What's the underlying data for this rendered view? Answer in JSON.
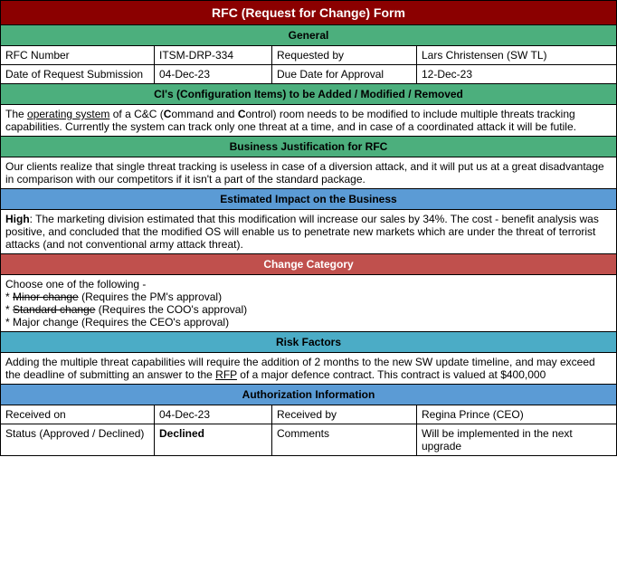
{
  "title": "RFC (Request for Change) Form",
  "sections": {
    "general": {
      "label": "General",
      "rfc_number_label": "RFC Number",
      "rfc_number_value": "ITSM-DRP-334",
      "requested_by_label": "Requested by",
      "requested_by_value": "Lars Christensen (SW TL)",
      "date_submission_label": "Date of Request Submission",
      "date_submission_value": "04-Dec-23",
      "due_date_label": "Due Date for Approval",
      "due_date_value": "12-Dec-23"
    },
    "ci": {
      "label": "CI's (Configuration Items) to be Added / Modified / Removed",
      "content": "The operating system of a C&C (Command and Control) room needs to be modified to include multiple threats tracking capabilities. Currently the system can track only one threat at a time, and in case of a coordinated attack it will be futile."
    },
    "business_justification": {
      "label": "Business Justification for RFC",
      "content": "Our clients realize that single threat tracking is useless in case of a diversion attack, and it will put us at a great disadvantage in comparison with our competitors if it isn't a part of the standard package."
    },
    "estimated_impact": {
      "label": "Estimated Impact on the Business",
      "content_bold": "High",
      "content_rest": ": The marketing division estimated that this modification will increase our sales by 34%. The cost - benefit analysis was positive, and concluded that the modified OS will enable us to penetrate new markets which are under the threat of terrorist attacks (and not conventional army attack threat)."
    },
    "change_category": {
      "label": "Change Category",
      "line1": "Choose one of the following -",
      "line2_prefix": "* ",
      "line2_strike": "Minor change",
      "line2_suffix": " (Requires the PM's approval)",
      "line3_prefix": "* ",
      "line3_strike": "Standard change",
      "line3_suffix": " (Requires the COO's approval)",
      "line4": "* Major change (Requires the CEO's approval)"
    },
    "risk_factors": {
      "label": "Risk Factors",
      "content_pre": "Adding the multiple threat capabilities will require the addition of 2 months to the new SW update timeline, and may exceed the deadline of submitting an answer to the ",
      "rfp_text": "RFP",
      "content_post": " of a major defence contract. This contract is valued at $400,000"
    },
    "authorization": {
      "label": "Authorization Information",
      "received_on_label": "Received on",
      "received_on_value": "04-Dec-23",
      "received_by_label": "Received by",
      "received_by_value": "Regina Prince (CEO)",
      "status_label": "Status (Approved / Declined)",
      "status_value": "Declined",
      "comments_label": "Comments",
      "comments_value": "Will be implemented in the next upgrade"
    }
  }
}
